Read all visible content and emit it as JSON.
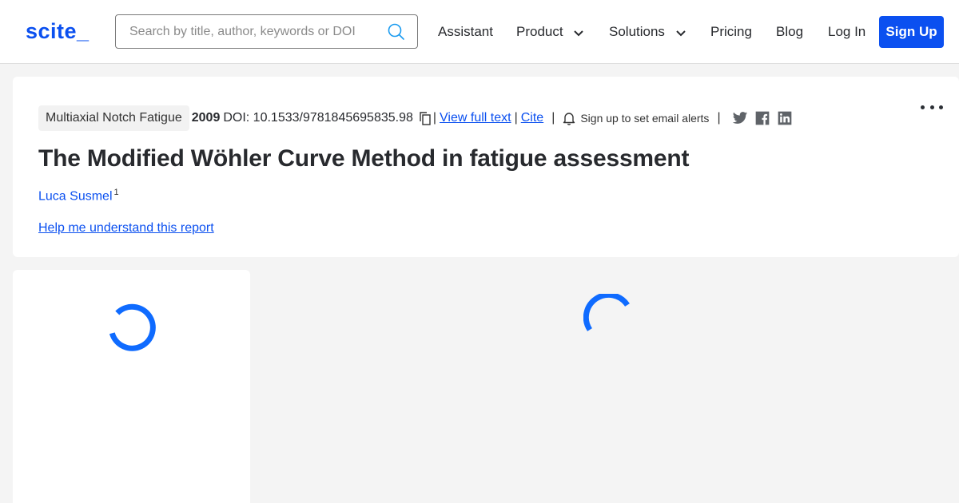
{
  "header": {
    "logo": "scite_",
    "search_placeholder": "Search by title, author, keywords or DOI",
    "nav": {
      "assistant": "Assistant",
      "product": "Product",
      "solutions": "Solutions",
      "pricing": "Pricing",
      "blog": "Blog",
      "login": "Log In",
      "signup": "Sign Up"
    }
  },
  "report": {
    "tag": "Multiaxial Notch Fatigue",
    "year": "2009",
    "doi": "DOI: 10.1533/9781845695835.98",
    "separator": "|",
    "view_full_text": "View full text",
    "cite": "Cite",
    "alerts": "Sign up to set email alerts",
    "title": "The Modified Wöhler Curve Method in fatigue assessment",
    "author": "Luca Susmel",
    "author_affiliation": "1",
    "help_link": "Help me understand this report"
  },
  "colors": {
    "brand": "#0b50f0",
    "spinner": "#0f6bff",
    "social_icons": "#5f6368"
  }
}
